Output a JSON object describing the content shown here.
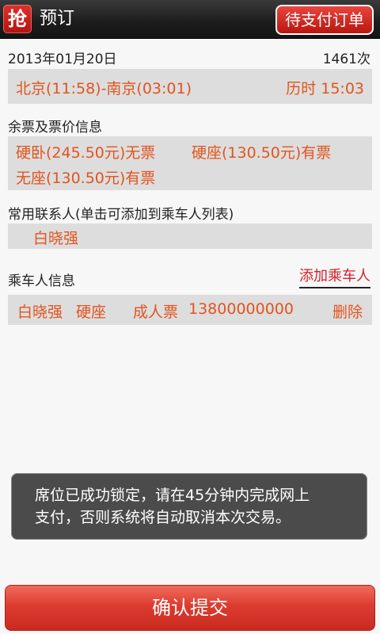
{
  "titlebar": {
    "app_icon": "抢",
    "title": "预订",
    "pending_orders_label": "待支付订单"
  },
  "trip": {
    "date": "2013年01月20日",
    "train_no": "1461次",
    "route": "北京(11:58)-南京(03:01)",
    "duration": "历时 15:03"
  },
  "tickets": {
    "section_label": "余票及票价信息",
    "items": [
      "硬卧(245.50元)无票",
      "硬座(130.50元)有票",
      "无座(130.50元)有票"
    ]
  },
  "contacts": {
    "section_label": "常用联系人(单击可添加到乘车人列表)",
    "items": [
      "白晓强"
    ]
  },
  "passengers": {
    "section_label": "乘车人信息",
    "add_label": "添加乘车人",
    "items": [
      {
        "name": "白晓强",
        "seat": "硬座",
        "ticket_type": "成人票",
        "phone": "13800000000",
        "delete_label": "删除"
      }
    ]
  },
  "toast": {
    "line1": "席位已成功锁定，请在45分钟内完成网上",
    "line2": "支付，否则系统将自动取消本次交易。"
  },
  "confirm_label": "确认提交",
  "colors": {
    "accent_red": "#dc3c30",
    "value_orange": "#e2541e",
    "titlebar": "#1c1c1c"
  }
}
